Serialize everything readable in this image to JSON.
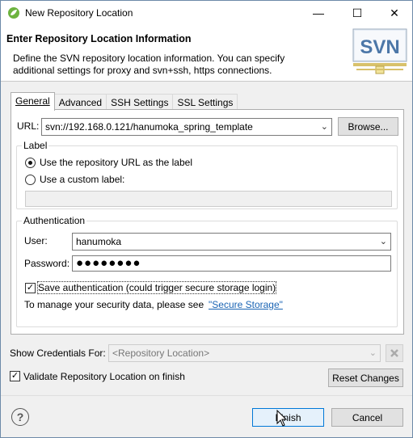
{
  "window": {
    "title": "New Repository Location",
    "minimize_glyph": "—",
    "maximize_glyph": "☐",
    "close_glyph": "✕"
  },
  "header": {
    "title": "Enter Repository Location Information",
    "description_line1": "Define the SVN repository location information. You can specify",
    "description_line2": "additional settings for proxy and svn+ssh, https connections.",
    "logo_text": "SVN"
  },
  "tabs": [
    {
      "label": "General",
      "active": true
    },
    {
      "label": "Advanced",
      "active": false
    },
    {
      "label": "SSH Settings",
      "active": false
    },
    {
      "label": "SSL Settings",
      "active": false
    }
  ],
  "general": {
    "url_label": "URL:",
    "url_value": "svn://192.168.0.121/hanumoka_spring_template",
    "browse_label": "Browse...",
    "label_group_title": "Label",
    "use_repo_url_label": "Use the repository URL as the label",
    "use_custom_label": "Use a custom label:",
    "custom_label_value": "",
    "auth_group_title": "Authentication",
    "user_label": "User:",
    "user_value": "hanumoka",
    "password_label": "Password:",
    "password_mask": "●●●●●●●●",
    "save_auth_label": "Save authentication (could trigger secure storage login)",
    "save_auth_checked": true,
    "secure_storage_text": "To manage your security data, please see",
    "secure_storage_link": "\"Secure Storage\""
  },
  "bottom": {
    "show_credentials_label": "Show Credentials For:",
    "show_credentials_value": "<Repository Location>",
    "validate_label": "Validate Repository Location on finish",
    "validate_checked": true,
    "reset_label": "Reset Changes"
  },
  "footer": {
    "help_glyph": "?",
    "finish_label": "Finish",
    "cancel_label": "Cancel"
  },
  "icons": {
    "app": "eclipse-spring-icon",
    "logo": "svn-logo-icon",
    "help": "help-icon",
    "delete": "delete-x-icon"
  }
}
